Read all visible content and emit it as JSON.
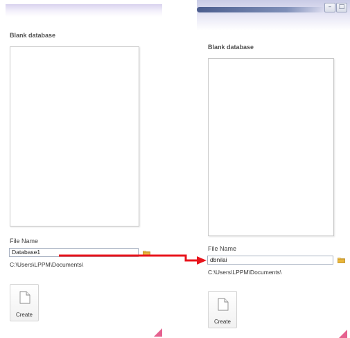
{
  "left_panel": {
    "section_title": "Blank database",
    "file_name_label": "File Name",
    "file_name_value": "Database1",
    "path": "C:\\Users\\LPPM\\Documents\\",
    "create_label": "Create"
  },
  "right_panel": {
    "section_title": "Blank database",
    "file_name_label": "File Name",
    "file_name_value": "dbnilai",
    "path": "C:\\Users\\LPPM\\Documents\\",
    "create_label": "Create",
    "window_buttons": [
      "–",
      "□"
    ]
  },
  "colors": {
    "arrow": "#e8141c",
    "folder": "#e9b63a",
    "accent_pink": "#e0457b"
  }
}
